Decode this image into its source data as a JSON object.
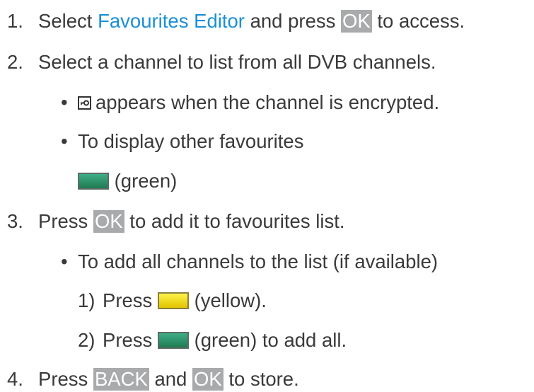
{
  "steps": [
    {
      "number": "1.",
      "text_before": "Select ",
      "link": "Favourites Editor",
      "text_mid": " and press ",
      "key": "OK",
      "text_after": " to access."
    },
    {
      "number": "2.",
      "text": "Select a channel to list from all DVB channels.",
      "bullets": [
        {
          "icon": "encrypted-lock-icon",
          "text": "appears when the channel is encrypted."
        },
        {
          "text": "To display other favourites",
          "button_color": "green",
          "button_label": "(green)"
        }
      ]
    },
    {
      "number": "3.",
      "text_before": "Press ",
      "key": "OK",
      "text_after": " to add it to favourites list.",
      "bullet": "To add all channels to the list (if available)",
      "substeps": [
        {
          "number": "1)",
          "text_before": "Press",
          "button_color": "yellow",
          "text_after": "(yellow)."
        },
        {
          "number": "2)",
          "text_before": "Press",
          "button_color": "green",
          "text_after": "(green) to add all."
        }
      ]
    },
    {
      "number": "4.",
      "text_before": "Press ",
      "key1": "BACK",
      "text_mid": " and ",
      "key2": "OK",
      "text_after": " to store."
    }
  ],
  "colors": {
    "text": "#3a3a3a",
    "link": "#1a8fd6",
    "key_background": "#a8aaab",
    "button_green": "#2e9466",
    "button_yellow": "#f0dc10"
  }
}
